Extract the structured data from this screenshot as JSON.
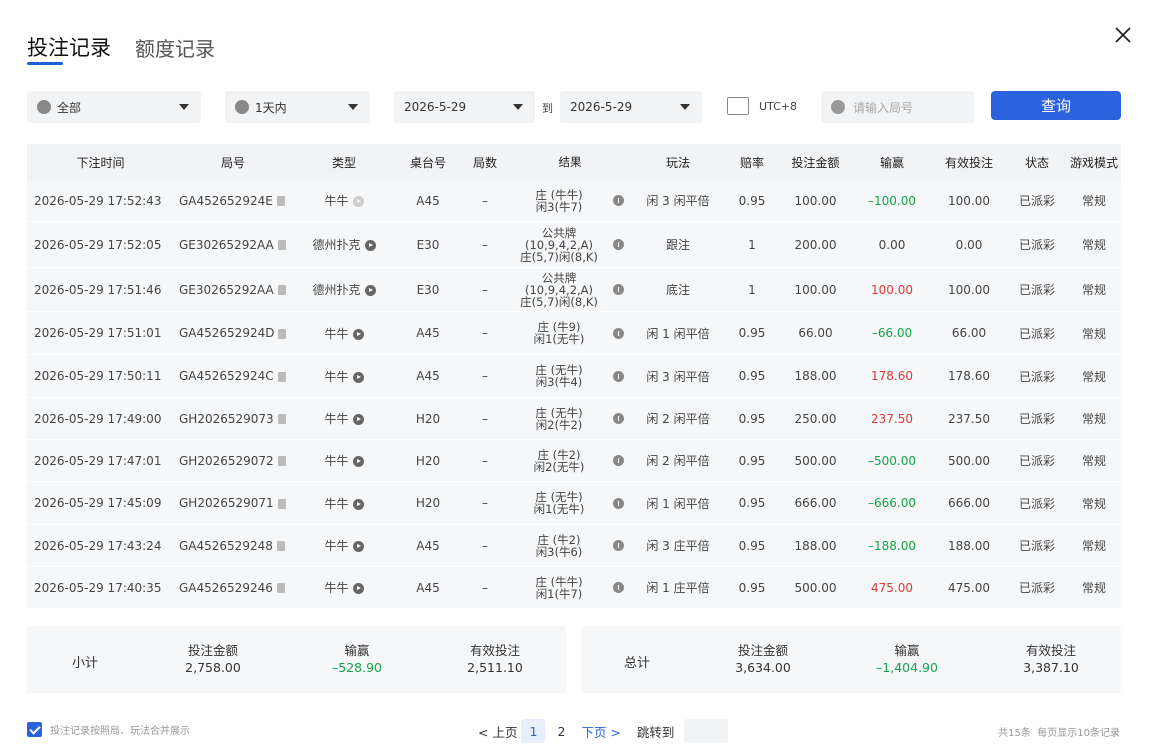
{
  "tabs": [
    {
      "label": "投注记录"
    },
    {
      "label": "额度记录"
    }
  ],
  "filters": {
    "game": "全部",
    "period": "1天内",
    "date_from": "2026-5-29",
    "to_label": "到",
    "date_to": "2026-5-29",
    "timezone": "UTC+8",
    "round_placeholder": "请输入局号",
    "query_label": "查询"
  },
  "table": {
    "headers": [
      "下注时间",
      "局号",
      "类型",
      "桌台号",
      "局数",
      "结果",
      "玩法",
      "赔率",
      "投注金额",
      "输赢",
      "有效投注",
      "状态",
      "游戏模式"
    ],
    "rows": [
      {
        "time": "2026-05-29 17:52:43",
        "round": "GA452652924E",
        "type": "牛牛",
        "table": "A45",
        "shoe": "–",
        "result": [
          "庄 (牛牛)",
          "闲3(牛7)"
        ],
        "play": "闲 3 闲平倍",
        "odds": "0.95",
        "bet": "100.00",
        "win": "–100.00",
        "win_color": "green",
        "valid": "100.00",
        "status": "已派彩",
        "mode": "常规"
      },
      {
        "time": "2026-05-29 17:52:05",
        "round": "GE30265292AA",
        "type": "德州扑克",
        "table": "E30",
        "shoe": "–",
        "result": [
          "公共牌",
          "(10,9,4,2,A)",
          "庄(5,7)闲(8,K)"
        ],
        "play": "跟注",
        "odds": "1",
        "bet": "200.00",
        "win": "0.00",
        "win_color": "black",
        "valid": "0.00",
        "status": "已派彩",
        "mode": "常规"
      },
      {
        "time": "2026-05-29 17:51:46",
        "round": "GE30265292AA",
        "type": "德州扑克",
        "table": "E30",
        "shoe": "–",
        "result": [
          "公共牌",
          "(10,9,4,2,A)",
          "庄(5,7)闲(8,K)"
        ],
        "play": "底注",
        "odds": "1",
        "bet": "100.00",
        "win": "100.00",
        "win_color": "red",
        "valid": "100.00",
        "status": "已派彩",
        "mode": "常规"
      },
      {
        "time": "2026-05-29 17:51:01",
        "round": "GA452652924D",
        "type": "牛牛",
        "table": "A45",
        "shoe": "–",
        "result": [
          "庄 (牛9)",
          "闲1(无牛)"
        ],
        "play": "闲 1 闲平倍",
        "odds": "0.95",
        "bet": "66.00",
        "win": "–66.00",
        "win_color": "green",
        "valid": "66.00",
        "status": "已派彩",
        "mode": "常规"
      },
      {
        "time": "2026-05-29 17:50:11",
        "round": "GA452652924C",
        "type": "牛牛",
        "table": "A45",
        "shoe": "–",
        "result": [
          "庄 (无牛)",
          "闲3(牛4)"
        ],
        "play": "闲 3 闲平倍",
        "odds": "0.95",
        "bet": "188.00",
        "win": "178.60",
        "win_color": "red",
        "valid": "178.60",
        "status": "已派彩",
        "mode": "常规"
      },
      {
        "time": "2026-05-29 17:49:00",
        "round": "GH2026529073",
        "type": "牛牛",
        "table": "H20",
        "shoe": "–",
        "result": [
          "庄 (无牛)",
          "闲2(牛2)"
        ],
        "play": "闲 2 闲平倍",
        "odds": "0.95",
        "bet": "250.00",
        "win": "237.50",
        "win_color": "red",
        "valid": "237.50",
        "status": "已派彩",
        "mode": "常规"
      },
      {
        "time": "2026-05-29 17:47:01",
        "round": "GH2026529072",
        "type": "牛牛",
        "table": "H20",
        "shoe": "–",
        "result": [
          "庄 (牛2)",
          "闲2(无牛)"
        ],
        "play": "闲 2 闲平倍",
        "odds": "0.95",
        "bet": "500.00",
        "win": "–500.00",
        "win_color": "green",
        "valid": "500.00",
        "status": "已派彩",
        "mode": "常规"
      },
      {
        "time": "2026-05-29 17:45:09",
        "round": "GH2026529071",
        "type": "牛牛",
        "table": "H20",
        "shoe": "–",
        "result": [
          "庄 (无牛)",
          "闲1(无牛)"
        ],
        "play": "闲 1 闲平倍",
        "odds": "0.95",
        "bet": "666.00",
        "win": "–666.00",
        "win_color": "green",
        "valid": "666.00",
        "status": "已派彩",
        "mode": "常规"
      },
      {
        "time": "2026-05-29 17:43:24",
        "round": "GA4526529248",
        "type": "牛牛",
        "table": "A45",
        "shoe": "–",
        "result": [
          "庄 (牛2)",
          "闲3(牛6)"
        ],
        "play": "闲 3 庄平倍",
        "odds": "0.95",
        "bet": "188.00",
        "win": "–188.00",
        "win_color": "green",
        "valid": "188.00",
        "status": "已派彩",
        "mode": "常规"
      },
      {
        "time": "2026-05-29 17:40:35",
        "round": "GA4526529246",
        "type": "牛牛",
        "table": "A45",
        "shoe": "–",
        "result": [
          "庄 (牛牛)",
          "闲1(牛7)"
        ],
        "play": "闲 1 庄平倍",
        "odds": "0.95",
        "bet": "500.00",
        "win": "475.00",
        "win_color": "red",
        "valid": "475.00",
        "status": "已派彩",
        "mode": "常规"
      }
    ]
  },
  "subtotal": {
    "label": "小计",
    "bet_label": "投注金额",
    "bet": "2,758.00",
    "win_label": "输赢",
    "win": "–528.90",
    "valid_label": "有效投注",
    "valid": "2,511.10"
  },
  "total": {
    "label": "总计",
    "bet_label": "投注金额",
    "bet": "3,634.00",
    "win_label": "输赢",
    "win": "–1,404.90",
    "valid_label": "有效投注",
    "valid": "3,387.10"
  },
  "footer": {
    "merge_label": "投注记录按照局、玩法合并展示",
    "prev": "< 上页",
    "pages": [
      "1",
      "2"
    ],
    "current_page": "1",
    "next": "下页 >",
    "jump_label": "跳转到",
    "total_count": "共15条",
    "per_page": "每页显示10条记录"
  },
  "colors": {
    "accent": "#2a63dd",
    "loss": "#16a34a",
    "gain": "#e03a3a"
  }
}
